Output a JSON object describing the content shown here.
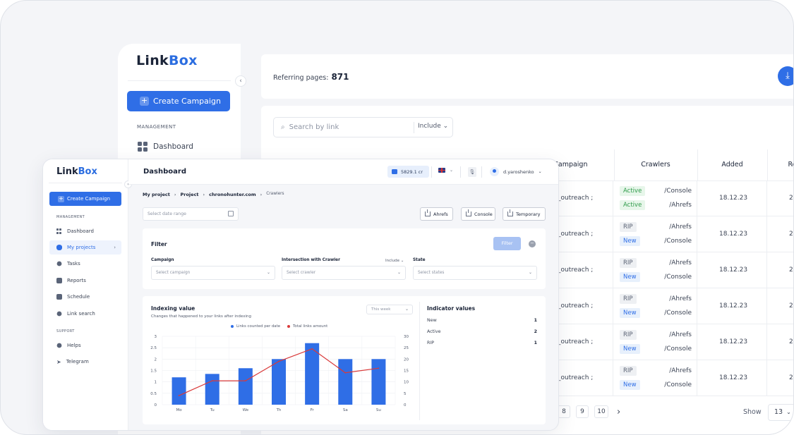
{
  "back": {
    "logo_a": "Link",
    "logo_b": "Box",
    "create_label": "Create Campaign",
    "management_label": "MANAGEMENT",
    "dashboard_label": "Dashboard",
    "referring_label": "Referring pages:",
    "referring_value": "871",
    "search_placeholder": "Search by link",
    "include_label": "Include",
    "columns": [
      "Campaign",
      "Crawlers",
      "Added",
      "Re"
    ],
    "rows": [
      {
        "campaign": "_outreach ;",
        "c1_tag": "Active",
        "c1_val": "/Console",
        "c2_tag": "Active",
        "c2_val": "/Ahrefs",
        "added": "18.12.23",
        "re": "2"
      },
      {
        "campaign": "_outreach ;",
        "c1_tag": "RIP",
        "c1_val": "/Ahrefs",
        "c2_tag": "New",
        "c2_val": "/Console",
        "added": "18.12.23",
        "re": "2"
      },
      {
        "campaign": "_outreach ;",
        "c1_tag": "RIP",
        "c1_val": "/Ahrefs",
        "c2_tag": "New",
        "c2_val": "/Console",
        "added": "18.12.23",
        "re": "2"
      },
      {
        "campaign": "_outreach ;",
        "c1_tag": "RIP",
        "c1_val": "/Ahrefs",
        "c2_tag": "New",
        "c2_val": "/Console",
        "added": "18.12.23",
        "re": "2"
      },
      {
        "campaign": "_outreach ;",
        "c1_tag": "RIP",
        "c1_val": "/Ahrefs",
        "c2_tag": "New",
        "c2_val": "/Console",
        "added": "18.12.23",
        "re": "2"
      },
      {
        "campaign": "_outreach ;",
        "c1_tag": "RIP",
        "c1_val": "/Ahrefs",
        "c2_tag": "New",
        "c2_val": "/Console",
        "added": "18.12.23",
        "re": "2"
      }
    ],
    "pages": [
      "8",
      "9",
      "10"
    ],
    "next_icon": "chevron-right-icon",
    "show_label": "Show",
    "page_size": "13"
  },
  "front": {
    "logo_a": "Link",
    "logo_b": "Box",
    "create_label": "Create Campaign",
    "management_label": "MANAGEMENT",
    "support_label": "SUPPORT",
    "nav": {
      "dashboard": "Dashboard",
      "projects": "My projects",
      "tasks": "Tasks",
      "reports": "Reports",
      "schedule": "Schedule",
      "link_search": "Link search",
      "helps": "Helps",
      "telegram": "Telegram"
    },
    "page_title": "Dashboard",
    "credits": "5829.1 cr",
    "user": "d.yaroshenko",
    "breadcrumb": [
      "My project",
      "Project",
      "chronohunter.com",
      "Crawlers"
    ],
    "date_placeholder": "Select date range",
    "buttons": {
      "ahrefs": "Ahrefs",
      "console": "Console",
      "temporary": "Temporary"
    },
    "filter": {
      "title": "Filter",
      "button": "Filter",
      "campaign_label": "Campaign",
      "campaign_placeholder": "Select campaign",
      "intersection_label": "Intersection with Crawler",
      "include_label": "Include",
      "crawler_placeholder": "Select crawler",
      "state_label": "State",
      "state_placeholder": "Select states"
    },
    "chart_card": {
      "title": "Indexing value",
      "subtitle": "Changes that happened to your links after indexing",
      "period": "This week",
      "legend_bar": "Links counted per date",
      "legend_line": "Total links amount"
    },
    "indicator": {
      "title": "Indicator values",
      "rows": [
        {
          "label": "New",
          "value": "1"
        },
        {
          "label": "Active",
          "value": "2"
        },
        {
          "label": "RIP",
          "value": "1"
        }
      ]
    }
  },
  "colors": {
    "accent": "#2f6ee6",
    "line": "#d93a3a",
    "active": "#2f9b4a"
  },
  "chart_data": {
    "type": "bar",
    "categories": [
      "Mo",
      "Tu",
      "We",
      "Th",
      "Fr",
      "Sa",
      "Su"
    ],
    "series": [
      {
        "name": "Links counted per date",
        "type": "bar",
        "axis": "left",
        "values": [
          1.2,
          1.35,
          1.6,
          2.0,
          2.7,
          2.0,
          2.0
        ]
      },
      {
        "name": "Total links amount",
        "type": "line",
        "axis": "right",
        "values": [
          4,
          10.5,
          10.5,
          19,
          24.5,
          14,
          16
        ]
      }
    ],
    "ylim_left": [
      0,
      3
    ],
    "yticks_left": [
      "0",
      "0.5",
      "1",
      "1.5",
      "2",
      "2.5",
      "3"
    ],
    "ylim_right": [
      0,
      30
    ],
    "yticks_right": [
      "0",
      "5",
      "10",
      "15",
      "20",
      "25",
      "30"
    ],
    "grid": true,
    "legend_position": "top-center"
  }
}
